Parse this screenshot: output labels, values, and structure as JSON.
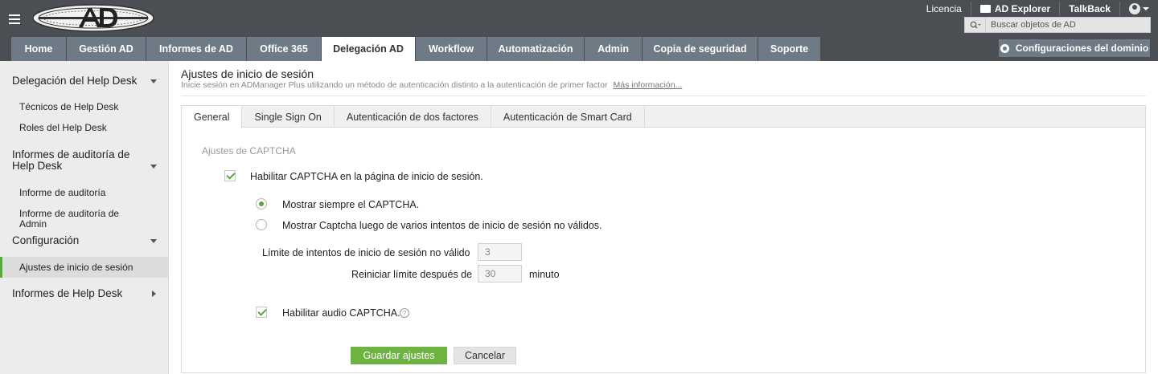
{
  "header": {
    "logo_icon": "admanager-logo",
    "links": {
      "licencia": "Licencia",
      "ad_explorer": "AD Explorer",
      "talkback": "TalkBack"
    },
    "search": {
      "placeholder": "Buscar objetos de AD"
    },
    "domain_settings": "Configuraciones del dominio"
  },
  "nav": {
    "tabs": [
      {
        "label": "Home"
      },
      {
        "label": "Gestión AD"
      },
      {
        "label": "Informes de AD"
      },
      {
        "label": "Office 365"
      },
      {
        "label": "Delegación AD",
        "active": true
      },
      {
        "label": "Workflow"
      },
      {
        "label": "Automatización"
      },
      {
        "label": "Admin"
      },
      {
        "label": "Copia de seguridad"
      },
      {
        "label": "Soporte"
      }
    ]
  },
  "sidebar": {
    "sections": [
      {
        "label": "Delegación del Help Desk",
        "items": [
          "Técnicos de Help Desk",
          "Roles del Help Desk"
        ]
      },
      {
        "label": "Informes de auditoría de Help Desk",
        "items": [
          "Informe de auditoría",
          "Informe de auditoría de Admin"
        ]
      },
      {
        "label": "Configuración",
        "items": [
          "Ajustes de inicio de sesión"
        ]
      },
      {
        "label": "Informes de Help Desk",
        "items": []
      }
    ],
    "active_item": "Ajustes de inicio de sesión"
  },
  "page": {
    "title": "Ajustes de inicio de sesión",
    "subtitle": "Inicie sesión en ADManager Plus utilizando un método de autenticación distinto a la autenticación de primer factor",
    "more_link": "Más información...",
    "tabs": [
      "General",
      "Single Sign On",
      "Autenticación de dos factores",
      "Autenticación de Smart Card"
    ],
    "active_tab": "General",
    "captcha": {
      "section_title": "Ajustes de CAPTCHA",
      "enable_label": "Habilitar CAPTCHA en la página de inicio de sesión.",
      "enable_checked": true,
      "always_label": "Mostrar siempre el CAPTCHA.",
      "always_selected": true,
      "after_label": "Mostrar Captcha luego de varios intentos de inicio de sesión no válidos.",
      "limit_label": "Límite de intentos de inicio de sesión no válido",
      "limit_value": "3",
      "reset_label": "Reiniciar límite después de",
      "reset_value": "30",
      "reset_unit": "minuto",
      "audio_label": "Habilitar audio CAPTCHA.",
      "audio_checked": true,
      "help_glyph": "?"
    },
    "buttons": {
      "save": "Guardar ajustes",
      "cancel": "Cancelar"
    }
  },
  "colors": {
    "topbar": "#4b4f54",
    "tab": "#6e7a85",
    "accent": "#6db33f"
  }
}
